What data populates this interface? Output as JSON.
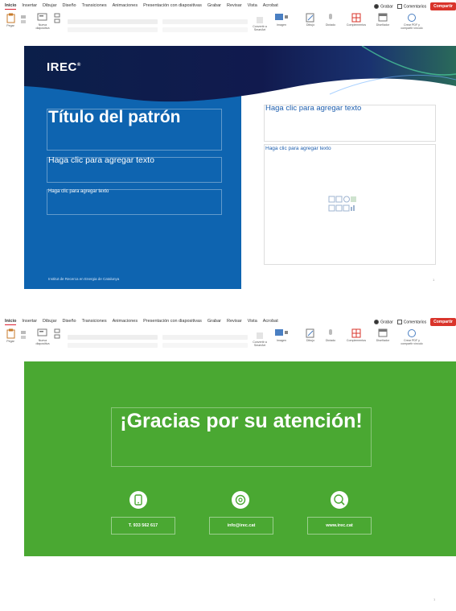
{
  "ribbon": {
    "tabs": [
      "Inicio",
      "Insertar",
      "Dibujar",
      "Diseño",
      "Transiciones",
      "Animaciones",
      "Presentación con diapositivas",
      "Grabar",
      "Revisar",
      "Vista",
      "Acrobat"
    ],
    "radio_label": "Grabar",
    "comments_label": "Comentarios",
    "share_label": "Compartir",
    "tools": {
      "paste": "Pegar",
      "new_slide": "Nueva diapositiva",
      "convert": "Convertir a SmartArt",
      "image": "Imagen",
      "draw": "Dibujo",
      "dictate": "Dictado",
      "addins": "Complementos",
      "designer": "Diseñador",
      "pdf": "Crear PDF y compartir vínculo"
    }
  },
  "slide1": {
    "logo": "IREC",
    "logo_mark": "®",
    "title": "Título del patrón",
    "subtitle": "Haga clic para agregar texto",
    "small_text": "Haga clic para agregar texto",
    "footer": "Institut de Recerca en Energia de Catalunya",
    "right_text_1": "Haga clic para agregar texto",
    "right_text_2": "Haga clic para agregar texto",
    "page_number": "1",
    "colors": {
      "blue": "#0e64b0",
      "link_blue": "#1f5fae"
    }
  },
  "slide2": {
    "title": "¡Gracias por su atención!",
    "contacts": [
      {
        "icon": "phone-icon",
        "label": "T. 933 562 617"
      },
      {
        "icon": "email-icon",
        "label": "info@irec.cat"
      },
      {
        "icon": "web-icon",
        "label": "www.irec.cat"
      }
    ],
    "page_number": "1",
    "colors": {
      "green": "#4aa832"
    }
  }
}
